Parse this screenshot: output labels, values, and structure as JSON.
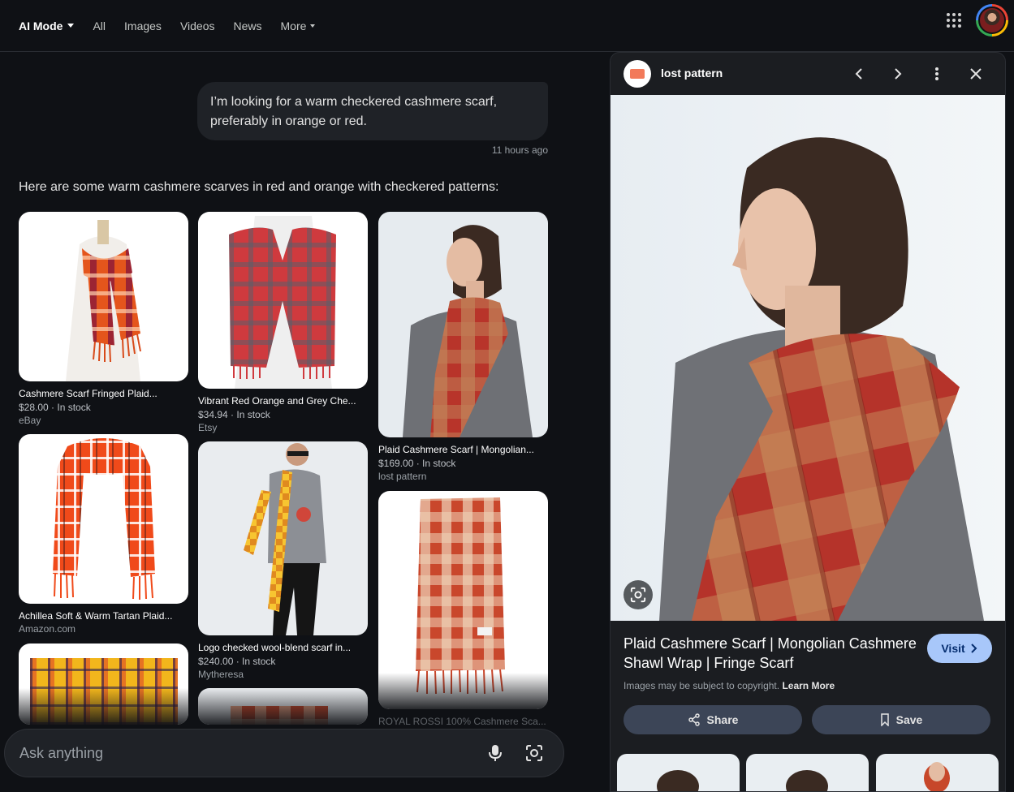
{
  "nav": {
    "mode_label": "AI Mode",
    "tabs": [
      "All",
      "Images",
      "Videos",
      "News",
      "More"
    ]
  },
  "chat": {
    "user_message": "I’m looking for a warm checkered cashmere scarf, preferably in orange or red.",
    "timestamp": "11 hours ago",
    "answer_intro": "Here are some warm cashmere scarves in red and orange with checkered patterns:"
  },
  "results": [
    {
      "title": "Cashmere Scarf Fringed Plaid...",
      "meta": "$28.00 · In stock",
      "source": "eBay"
    },
    {
      "title": "Vibrant Red Orange and Grey Che...",
      "meta": "$34.94 · In stock",
      "source": "Etsy"
    },
    {
      "title": "Plaid Cashmere Scarf | Mongolian...",
      "meta": "$169.00 · In stock",
      "source": "lost pattern"
    },
    {
      "title": "Achillea Soft & Warm Tartan Plaid...",
      "meta": "",
      "source": "Amazon.com"
    },
    {
      "title": "Logo checked wool-blend scarf in...",
      "meta": "$240.00 · In stock",
      "source": "Mytheresa"
    },
    {
      "title": "ROYAL ROSSI 100% Cashmere Sca...",
      "meta": "",
      "source": ""
    }
  ],
  "ask": {
    "placeholder": "Ask anything"
  },
  "detail": {
    "site_name": "lost pattern",
    "title": "Plaid Cashmere Scarf | Mongolian Cashmere Shawl Wrap | Fringe Scarf",
    "visit_label": "Visit",
    "copyright_text": "Images may be subject to copyright.",
    "learn_more": "Learn More",
    "share_label": "Share",
    "save_label": "Save"
  },
  "colors": {
    "background": "#0f1115",
    "panel": "#1b1d21",
    "visit_button": "#a8c7fa",
    "action_button": "#3c4557"
  }
}
